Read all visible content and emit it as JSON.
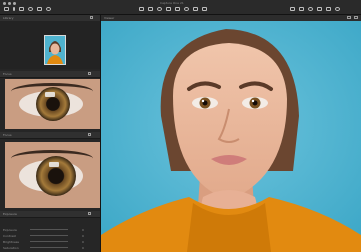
{
  "window": {
    "title": "Capture One 21"
  },
  "sidebar": {
    "library_header": "Library",
    "focus_header_1": "Focus",
    "focus_header_2": "Focus",
    "adjustments": {
      "header": "Exposure",
      "rows": [
        {
          "label": "Exposure",
          "value": "0"
        },
        {
          "label": "Contrast",
          "value": "0"
        },
        {
          "label": "Brightness",
          "value": "0"
        },
        {
          "label": "Saturation",
          "value": "0"
        }
      ]
    }
  },
  "viewer": {
    "label": "Viewer"
  },
  "colors": {
    "background": "#4ab2cf",
    "shirt": "#e28a10",
    "ui_dark": "#1f1f1f"
  },
  "icons": [
    "app-menu-icon",
    "import-icon",
    "crop-icon",
    "rotate-icon",
    "zoom-icon",
    "pan-icon",
    "brush-icon",
    "eraser-icon"
  ]
}
